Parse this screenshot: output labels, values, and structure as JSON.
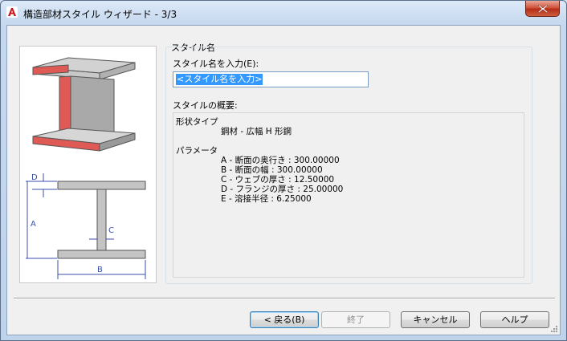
{
  "window": {
    "title": "構造部材スタイル ウィザード - 3/3"
  },
  "illustration": {
    "dims": [
      "D",
      "A",
      "C",
      "B"
    ]
  },
  "style_name": {
    "group_label": "スタイル名",
    "field_label": "スタイル名を入力(E):",
    "value": "<スタイル名を入力>"
  },
  "summary": {
    "label": "スタイルの概要:",
    "shape_type_label": "形状タイプ",
    "shape_type_value": "鋼材 - 広幅 H 形鋼",
    "parameters_label": "パラメータ",
    "parameters": [
      "A - 断面の奥行き : 300.00000",
      "B - 断面の幅 : 300.00000",
      "C - ウェブの厚さ : 12.50000",
      "D - フランジの厚さ : 25.00000",
      "E - 溶接半径 : 6.25000"
    ]
  },
  "buttons": {
    "back": "< 戻る(B)",
    "finish": "終了",
    "cancel": "キャンセル",
    "help": "ヘルプ"
  },
  "colors": {
    "accent_red": "#e05a55",
    "selection": "#3399ff"
  }
}
